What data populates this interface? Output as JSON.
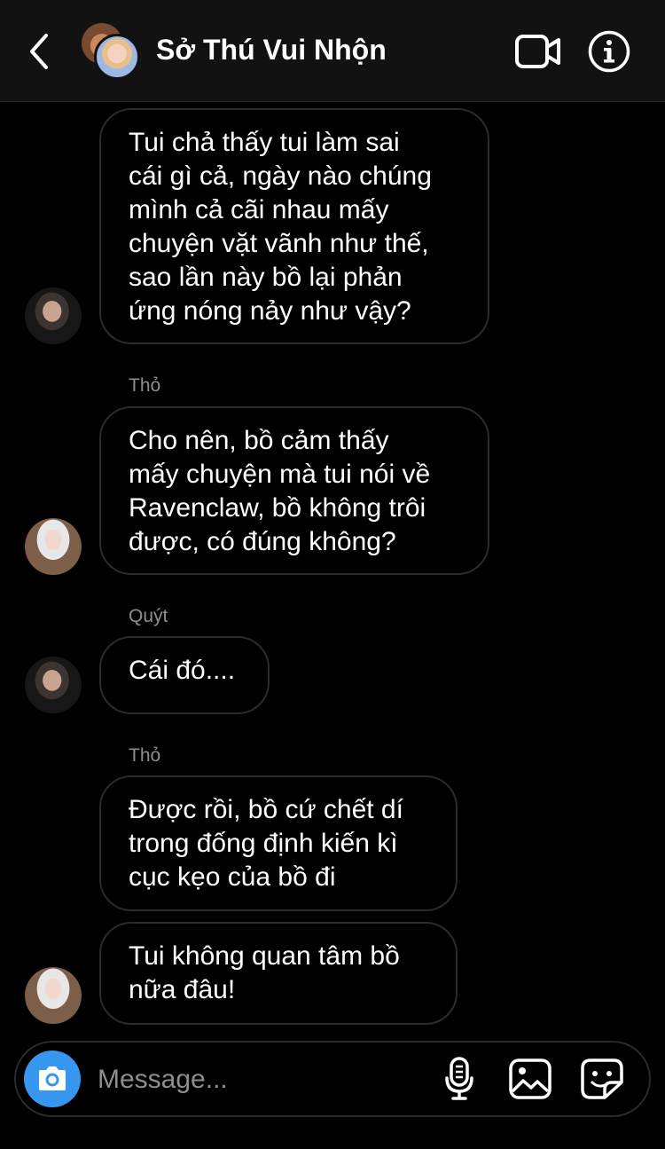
{
  "header": {
    "title": "Sở Thú Vui Nhộn",
    "back_icon": "chevron-left-icon",
    "video_icon": "video-camera-icon",
    "info_icon": "info-icon"
  },
  "messages": [
    {
      "sender": "",
      "text": "Tui chả thấy tui làm sai cái gì cả, ngày nào chúng mình cả cãi nhau mấy chuyện vặt vãnh như thế, sao lần này bồ lại phản ứng nóng nảy như vậy?",
      "lines": [
        "Tui chả thấy tui làm sai",
        "cái gì cả, ngày nào chúng",
        "mình cả cãi nhau mấy",
        "chuyện vặt vãnh như thế,",
        "sao lần này bồ lại phản",
        "ứng nóng nảy như vậy?"
      ]
    },
    {
      "sender": "Thỏ",
      "text": "Cho nên, bồ cảm thấy mấy chuyện mà tui nói về Ravenclaw, bồ không trôi được, có đúng không?",
      "lines": [
        "Cho nên, bồ cảm thấy",
        "mấy chuyện mà tui nói về",
        "Ravenclaw, bồ không trôi",
        "được, có đúng không?"
      ]
    },
    {
      "sender": "Quýt",
      "text": "Cái đó....",
      "lines": [
        "Cái đó...."
      ]
    },
    {
      "sender": "Thỏ",
      "text": "Được rồi, bồ cứ chết dí trong đống định kiến kì cục kẹo của bồ đi",
      "lines": [
        "Được rồi, bồ cứ chết dí",
        "trong đống định kiến kì",
        "cục kẹo của bồ đi"
      ]
    },
    {
      "sender": "",
      "text": "Tui không quan tâm bồ nữa đâu!",
      "lines": [
        "Tui không quan tâm bồ",
        "nữa đâu!"
      ]
    }
  ],
  "composer": {
    "placeholder": "Message...",
    "camera_icon": "camera-icon",
    "mic_icon": "microphone-icon",
    "gallery_icon": "image-gallery-icon",
    "sticker_icon": "sticker-icon",
    "accent_color": "#3797f0"
  },
  "colors": {
    "background": "#000000",
    "header_background": "#121212",
    "bubble_border": "#2b2b2b",
    "sender_text": "#8e8e8e"
  }
}
